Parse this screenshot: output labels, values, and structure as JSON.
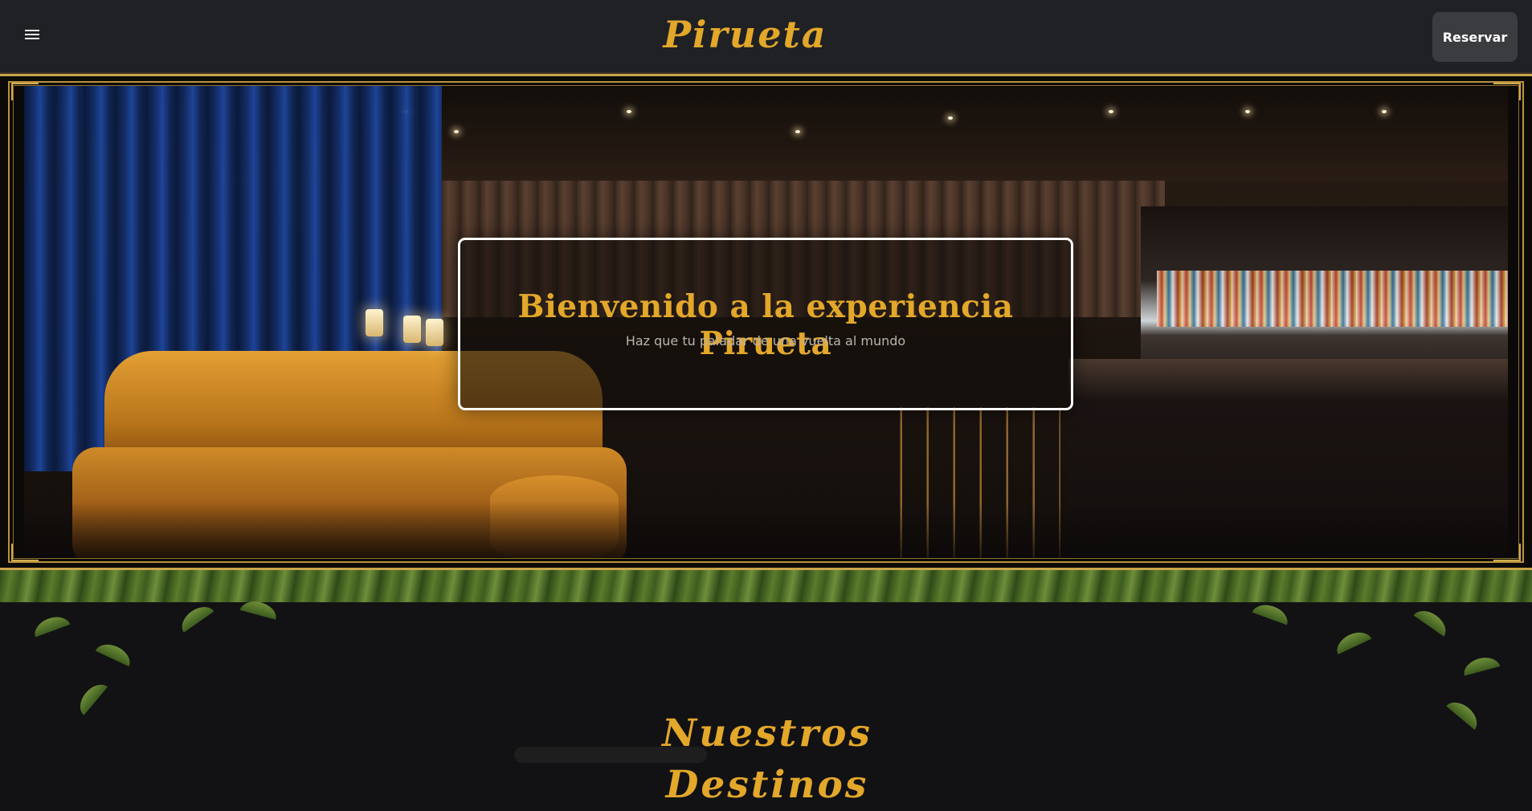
{
  "navbar": {
    "menu_icon": "hamburger-menu-icon",
    "brand": "Pirueta",
    "reserve_label": "Reservar"
  },
  "hero": {
    "title": "Bienvenido a la experiencia Pirueta",
    "subtitle": "Haz que tu paladar de una vuelta al mundo"
  },
  "destinations": {
    "title": "Nuestros Destinos"
  },
  "colors": {
    "accent_gold": "#e3a72a",
    "nav_bg": "#1f2125",
    "button_bg": "#3b3c3f",
    "frame_gold": "#c9a449",
    "page_bg": "#121215"
  }
}
